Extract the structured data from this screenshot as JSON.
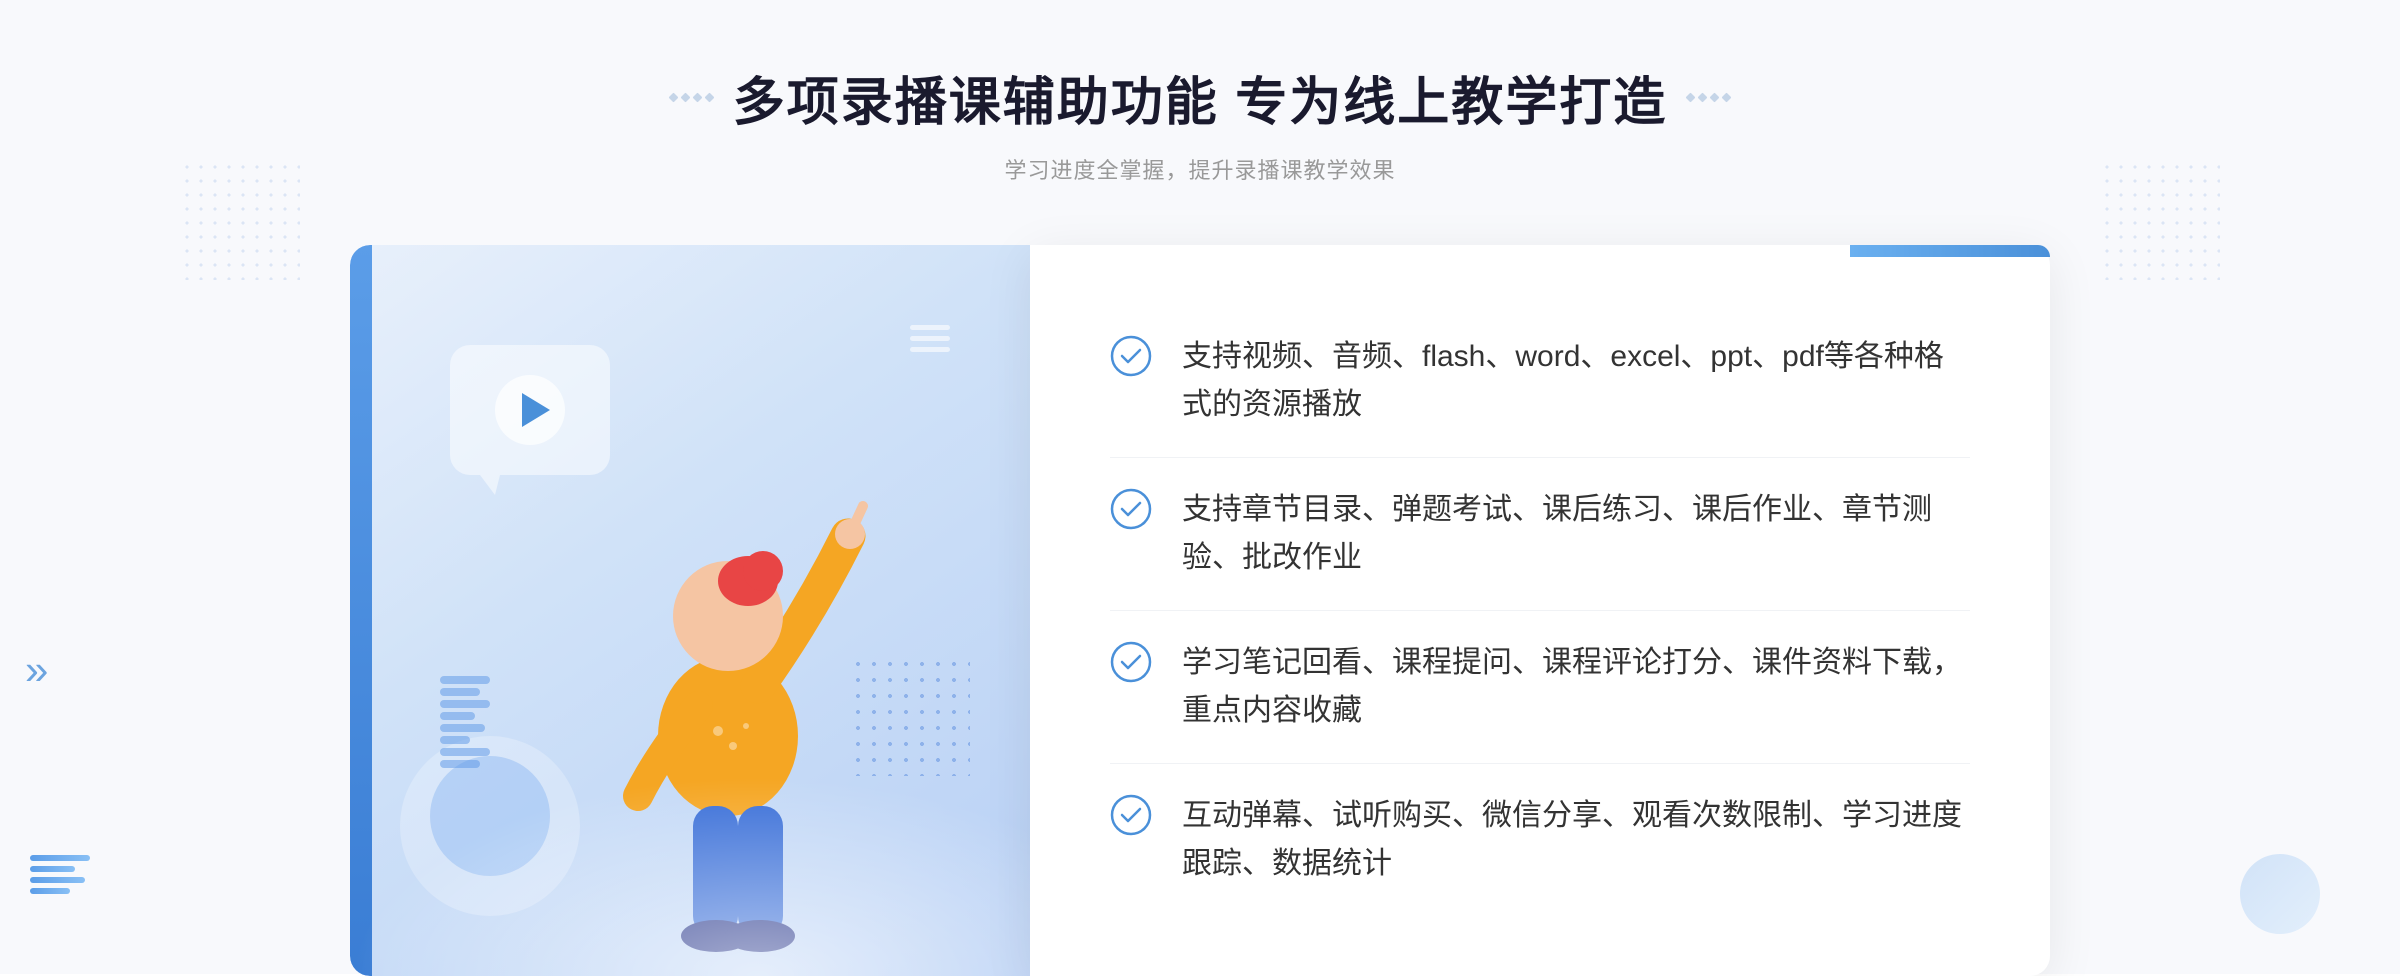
{
  "page": {
    "background": "#f8f9fc"
  },
  "header": {
    "title": "多项录播课辅助功能 专为线上教学打造",
    "subtitle": "学习进度全掌握，提升录播课教学效果",
    "title_dots_left": "decorative",
    "title_dots_right": "decorative"
  },
  "features": [
    {
      "id": 1,
      "text": "支持视频、音频、flash、word、excel、ppt、pdf等各种格式的资源播放"
    },
    {
      "id": 2,
      "text": "支持章节目录、弹题考试、课后练习、课后作业、章节测验、批改作业"
    },
    {
      "id": 3,
      "text": "学习笔记回看、课程提问、课程评论打分、课件资料下载，重点内容收藏"
    },
    {
      "id": 4,
      "text": "互动弹幕、试听购买、微信分享、观看次数限制、学习进度跟踪、数据统计"
    }
  ],
  "icons": {
    "play": "▶",
    "check": "check-circle",
    "left_arrow": "«",
    "right_arrow": "»"
  },
  "colors": {
    "primary": "#4a90d9",
    "primary_light": "#b8d4f5",
    "title_dark": "#1a1a2e",
    "text_main": "#333333",
    "subtitle_gray": "#999999",
    "bg_light": "#f8f9fc",
    "white": "#ffffff"
  }
}
